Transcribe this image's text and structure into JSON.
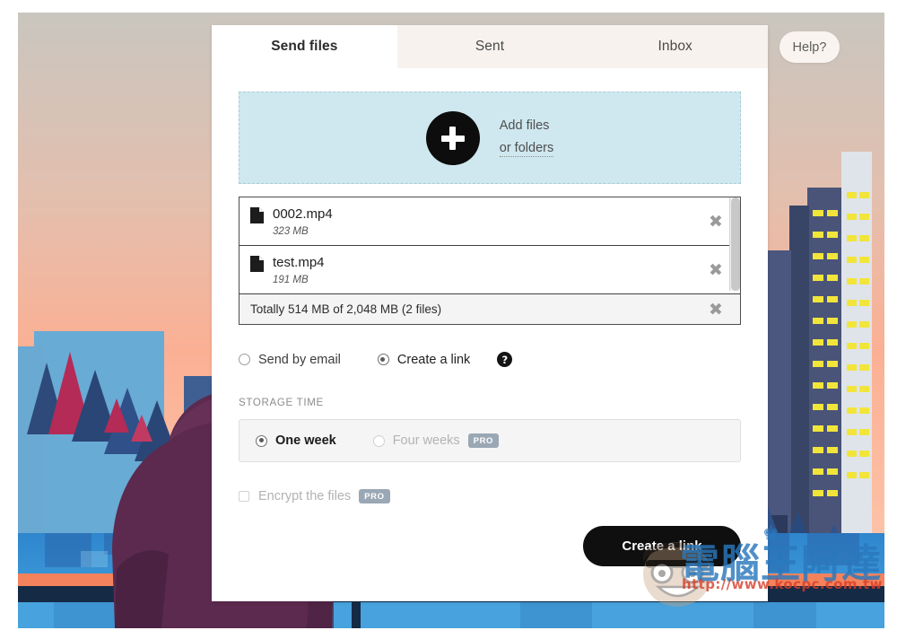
{
  "app": {
    "tabs": [
      {
        "label": "Send files",
        "active": true
      },
      {
        "label": "Sent",
        "active": false
      },
      {
        "label": "Inbox",
        "active": false
      }
    ],
    "help_label": "Help?"
  },
  "dropzone": {
    "icon": "plus-circle-icon",
    "primary_label": "Add files",
    "secondary_label": "or folders"
  },
  "files": {
    "items": [
      {
        "icon": "file-icon",
        "name": "0002.mp4",
        "size": "323 MB",
        "remove": "✖"
      },
      {
        "icon": "file-icon",
        "name": "test.mp4",
        "size": "191 MB",
        "remove": "✖"
      }
    ],
    "total_label": "Totally 514 MB of 2,048 MB (2 files)",
    "total_remove": "✖"
  },
  "send_mode": {
    "options": [
      {
        "label": "Send by email",
        "selected": false
      },
      {
        "label": "Create a link",
        "selected": true
      }
    ],
    "help_icon_glyph": "?"
  },
  "storage_time": {
    "section_label": "STORAGE TIME",
    "options": [
      {
        "label": "One week",
        "selected": true,
        "pro": false,
        "badge": ""
      },
      {
        "label": "Four weeks",
        "selected": false,
        "pro": true,
        "badge": "PRO"
      }
    ]
  },
  "encrypt": {
    "label": "Encrypt the files",
    "badge": "PRO",
    "checked": false
  },
  "cta": {
    "label": "Create a link"
  },
  "watermark": {
    "text_cn": "電腦王阿達",
    "url": "http://www.kocpc.com.tw",
    "crown_glyph": "♚"
  },
  "colors": {
    "dropzone_bg": "#cfe8ef",
    "accent_dark": "#0f0f0f",
    "pro_badge": "#9aa7b4",
    "tab_inactive_bg": "#f7f2ee",
    "sky_top": "#c9c6bf",
    "sky_bottom": "#fbc3a6",
    "water": "#2e8fd4",
    "hoodie": "#5b2a4e"
  }
}
